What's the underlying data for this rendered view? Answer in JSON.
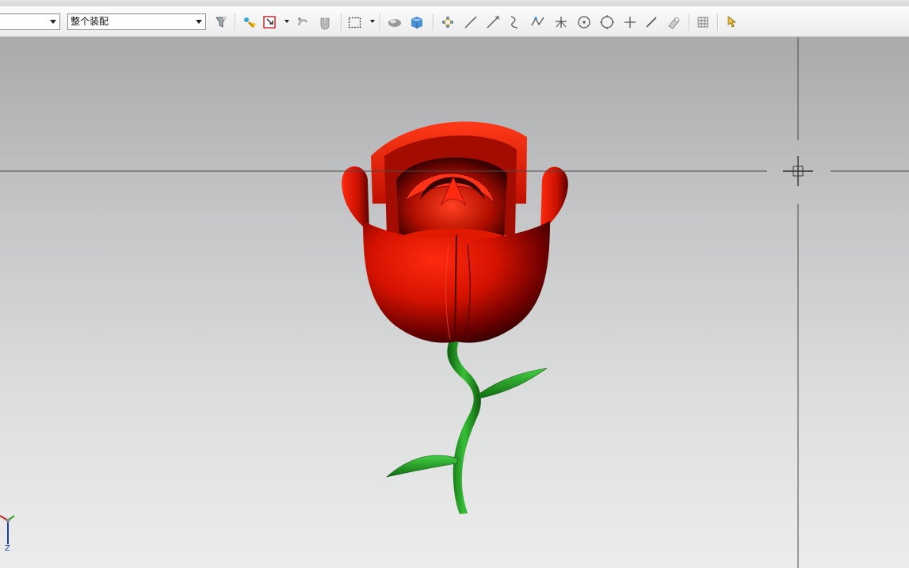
{
  "toolbar": {
    "selection_filter": {
      "value": ""
    },
    "assembly_scope": {
      "value": "整个装配"
    },
    "tools": [
      "filter-icon",
      "snap-point-icon",
      "select-box-icon",
      "move-icon",
      "magnet-icon",
      "rectangle-select-icon",
      "shaded-view-icon",
      "cube-view-icon",
      "nodes-icon",
      "line-icon",
      "line-arrow-icon",
      "curve-icon",
      "spline-icon",
      "point-plus-icon",
      "circle-dot-icon",
      "circle-icon",
      "plus-icon",
      "diagonal-line-icon",
      "measure-icon",
      "grid-icon",
      "pointer-icon"
    ]
  },
  "viewport": {
    "background_top": "#a9aaac",
    "background_bottom": "#ececec",
    "model": "rose",
    "petal_color": "#e81000",
    "stem_color": "#1b8a1b"
  },
  "triad": {
    "axis_label": "Z"
  }
}
